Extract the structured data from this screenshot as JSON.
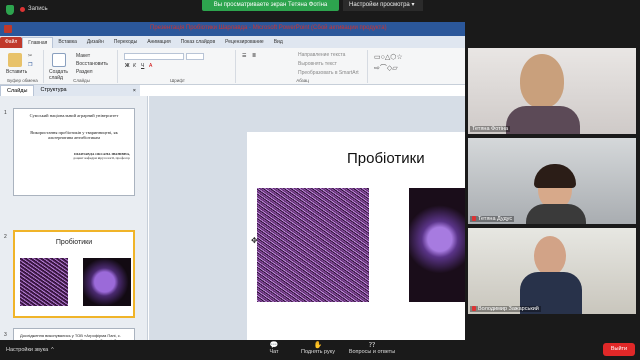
{
  "zoom": {
    "recording_label": "Запись",
    "share_banner": "Вы просматриваете экран Тетяна Фотіна",
    "view_options": "Настройки просмотра",
    "audio_settings": "Настройки звука",
    "chat": "Чат",
    "raise_hand": "Поднять руку",
    "qa": "Вопросы и ответы",
    "leave": "Выйти"
  },
  "ppt": {
    "window_title": "Презентація Пробіотики Шарлавда - Microsoft PowerPoint (Сбой активации продукта)",
    "tabs": [
      "Файл",
      "Главная",
      "Вставка",
      "Дизайн",
      "Переходы",
      "Анимация",
      "Показ слайдов",
      "Рецензирование",
      "Вид"
    ],
    "ribbon": {
      "paste": "Вставить",
      "clipboard_group": "Буфер обмена",
      "new_slide": "Создать слайд",
      "layout": "Макет",
      "reset": "Восстановить",
      "section": "Раздел",
      "slides_group": "Слайды",
      "font_group": "Шрифт",
      "paragraph_group": "Абзац",
      "text_direction": "Направление текста",
      "align_text": "Выровнять текст",
      "smartart": "Преобразовать в SmartArt"
    },
    "panel_tabs": [
      "Слайды",
      "Структура"
    ],
    "slide1": {
      "number": "1",
      "university": "Сумський національний аграрний університет",
      "topic": "Використання пробіотиків у тваринництві, як альтернатива антибіотикам",
      "author": "ШАРЛАВДА ОКСАНА ІВАНІВНА,",
      "author_role": "доцент кафедри вірусології, професор"
    },
    "slide2": {
      "number": "2",
      "title": "Пробіотики"
    },
    "slide3": {
      "number": "3",
      "text": "Дослідження виконувались у ТОВ «Агрофірма Пані, с. Кондратівка, Сумського району, Сумської області. Для проведення досліду використовували здорових поросят на місяці"
    },
    "main_slide_title": "Пробіотики"
  },
  "participants": [
    {
      "name": "Тетяна Фотіна",
      "muted": false
    },
    {
      "name": "Тетяна Дудус",
      "muted": true
    },
    {
      "name": "Володимир Зажарський",
      "muted": true
    }
  ],
  "colors": {
    "accent_red": "#e02828",
    "share_green": "#2da44e",
    "ppt_blue": "#2b579a"
  }
}
